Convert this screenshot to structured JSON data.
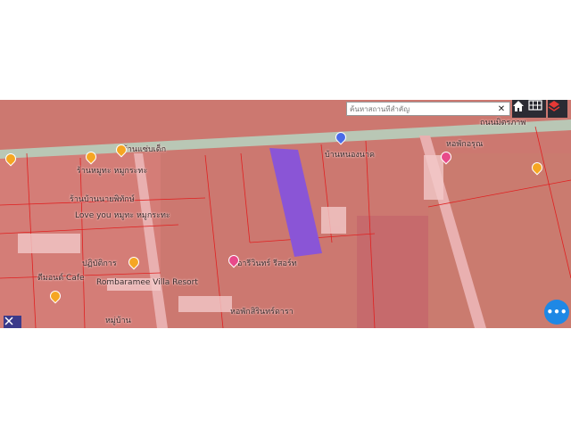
{
  "search": {
    "placeholder": "ค้นหาสถานที่สำคัญ",
    "clear_label": "✕"
  },
  "toolbar": {
    "home_icon": "home-icon",
    "grid_icon": "grid-icon",
    "layers_icon": "layers-icon"
  },
  "map": {
    "road_label": "ถนนมิตรภาพ",
    "places": [
      "ร้านแซ่บเด็ก",
      "ร้านหมูทะ หมูกระทะ",
      "ร้านบ้านนายพิทักษ์",
      "Love you หมูทะ หมูกระทะ",
      "ปฏิบัติการ",
      "ดีมอนด์ Cafe",
      "Rombaramee Villa Resort",
      "อารีวินทร์ รีสอร์ท",
      "หอพักสิรินทร์ดารา",
      "หมู่บ้าน",
      "บ้านหนองนาค",
      "หอพักอรุณ"
    ]
  },
  "colors": {
    "overlay": "#f07a7a",
    "highlight": "#8a55d6",
    "fab": "#1e88e5",
    "parcel_line": "#e02020"
  },
  "fab_label": "•••"
}
